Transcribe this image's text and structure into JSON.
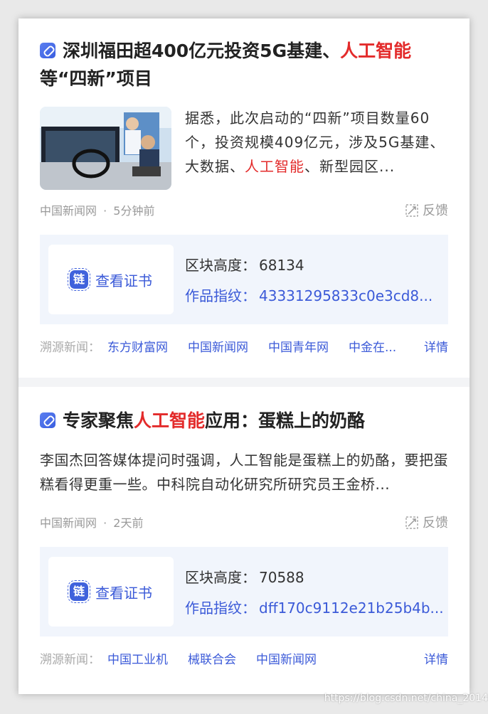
{
  "items": [
    {
      "title_parts": [
        "深圳福田超400亿元投资5G基建、",
        "人工智能",
        "等“四新”项目"
      ],
      "summary_parts": [
        "据悉，此次启动的“四新”项目数量60个，投资规模409亿元，涉及5G基建、大数据、",
        "人工智能",
        "、新型园区..."
      ],
      "source": "中国新闻网",
      "time": "5分钟前",
      "feedback": "反馈",
      "cert": {
        "button": "查看证书",
        "badge": "链",
        "block_label": "区块高度：",
        "block_value": "68134",
        "hash_label": "作品指纹：",
        "hash_value": "43331295833c0e3cd8..."
      },
      "trace_label": "溯源新闻：",
      "trace_sources": [
        "东方财富网",
        "中国新闻网",
        "中国青年网",
        "中金在..."
      ],
      "detail": "详情"
    },
    {
      "title_parts": [
        "专家聚焦",
        "人工智能",
        "应用：蛋糕上的奶酪"
      ],
      "summary": "李国杰回答媒体提问时强调，人工智能是蛋糕上的奶酪，要把蛋糕看得更重一些。中科院自动化研究所研究员王金桥...",
      "source": "中国新闻网",
      "time": "2天前",
      "feedback": "反馈",
      "cert": {
        "button": "查看证书",
        "badge": "链",
        "block_label": "区块高度：",
        "block_value": "70588",
        "hash_label": "作品指纹：",
        "hash_value": "dff170c9112e21b25b4b..."
      },
      "trace_label": "溯源新闻：",
      "trace_sources": [
        "中国工业机",
        "械联合会",
        "中国新闻网"
      ],
      "detail": "详情"
    }
  ],
  "watermark": "https://blog.csdn.net/china_2014",
  "colors": {
    "accent": "#3b5ad8",
    "highlight": "#e32b2b",
    "cert_bg": "#f1f5fc"
  }
}
